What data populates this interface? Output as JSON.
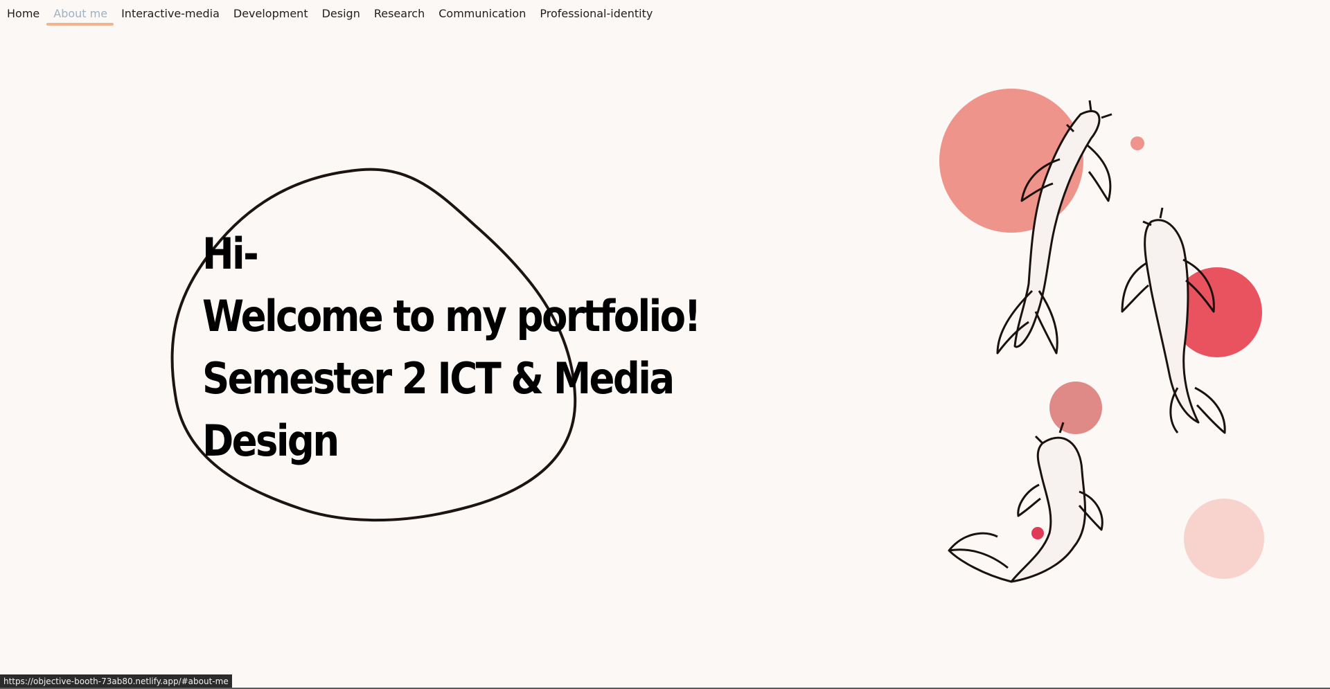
{
  "nav": {
    "items": [
      {
        "label": "Home"
      },
      {
        "label": "About me"
      },
      {
        "label": "Interactive-media"
      },
      {
        "label": "Development"
      },
      {
        "label": "Design"
      },
      {
        "label": "Research"
      },
      {
        "label": "Communication"
      },
      {
        "label": "Professional-identity"
      }
    ],
    "active_index": 1
  },
  "hero": {
    "line1": "Hi-",
    "line2": "Welcome to my portfolio!",
    "line3": "Semester 2 ICT & Media",
    "line4": "Design"
  },
  "status_bar": {
    "url": "https://objective-booth-73ab80.netlify.app/#about-me"
  },
  "colors": {
    "background": "#fcf8f6",
    "accent_underline": "#f1b48c",
    "active_nav_text": "#9fb1c2",
    "circle_salmon": "#ee948a",
    "circle_red": "#e9535f",
    "circle_rose": "#e08a87",
    "circle_blush": "#f8d3cd"
  },
  "icons": {
    "illustration": "koi-fish-illustration",
    "blob": "hand-drawn-blob-outline"
  }
}
